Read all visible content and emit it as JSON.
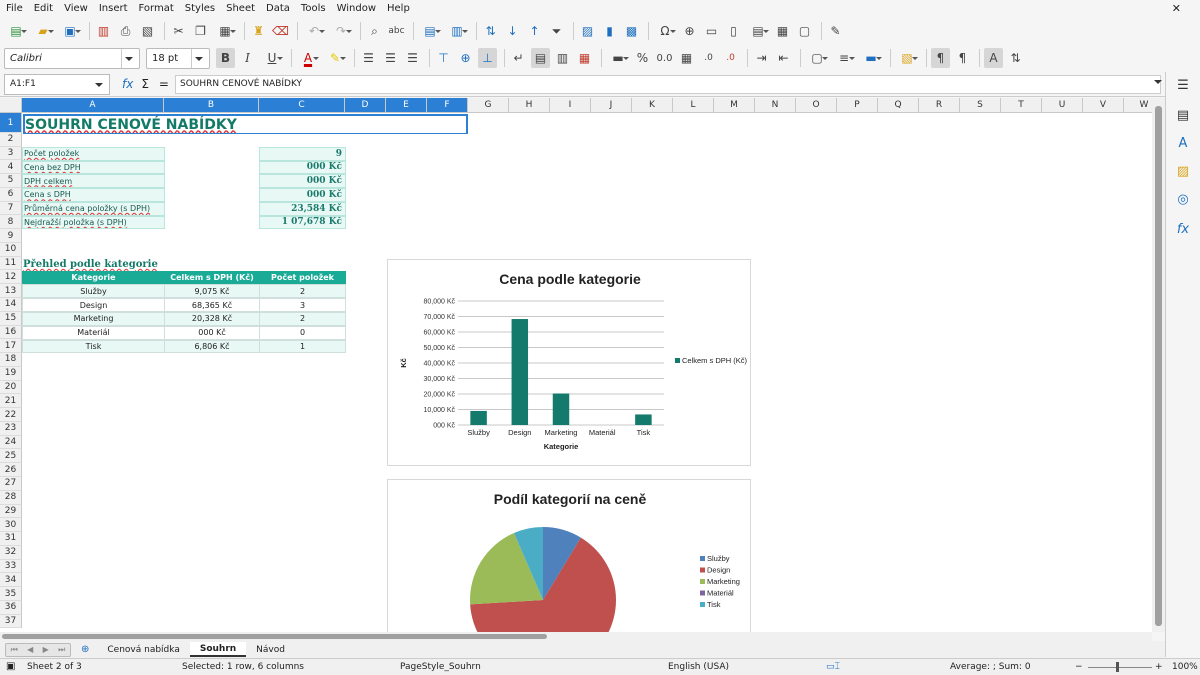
{
  "menu": [
    "File",
    "Edit",
    "View",
    "Insert",
    "Format",
    "Styles",
    "Sheet",
    "Data",
    "Tools",
    "Window",
    "Help"
  ],
  "font": {
    "name": "Calibri",
    "size": "18 pt"
  },
  "formula_bar": {
    "name_box": "A1:F1",
    "fx": "fx",
    "sigma": "Σ",
    "equals": "=",
    "content": "SOUHRN CENOVÉ NABÍDKY"
  },
  "columns": [
    "A",
    "B",
    "C",
    "D",
    "E",
    "F",
    "G",
    "H",
    "I",
    "J",
    "K",
    "L",
    "M",
    "N",
    "O",
    "P",
    "Q",
    "R",
    "S",
    "T",
    "U",
    "V",
    "W"
  ],
  "rows": [
    "1",
    "2",
    "3",
    "4",
    "5",
    "6",
    "7",
    "8",
    "9",
    "10",
    "11",
    "12",
    "13",
    "14",
    "15",
    "16",
    "17",
    "18",
    "19",
    "20",
    "21",
    "22",
    "23",
    "24",
    "25",
    "26",
    "27",
    "28",
    "29",
    "30",
    "31",
    "32",
    "33",
    "34",
    "35",
    "36",
    "37"
  ],
  "sheet": {
    "title": "SOUHRN CENOVÉ NABÍDKY",
    "summary": [
      {
        "label": "Počet položek",
        "value": "9"
      },
      {
        "label": "Cena bez DPH",
        "value": "000 Kč"
      },
      {
        "label": "DPH celkem",
        "value": "000 Kč"
      },
      {
        "label": "Cena s DPH",
        "value": "000 Kč"
      },
      {
        "label": "Průměrná cena položky (s DPH)",
        "value": "23,584 Kč"
      },
      {
        "label": "Nejdražší položka (s DPH)",
        "value": "1 07,678 Kč"
      }
    ],
    "category_title": "Přehled podle kategorie",
    "category_headers": [
      "Kategorie",
      "Celkem s DPH (Kč)",
      "Počet položek"
    ],
    "category_rows": [
      {
        "name": "Služby",
        "total": "9,075 Kč",
        "count": "2"
      },
      {
        "name": "Design",
        "total": "68,365 Kč",
        "count": "3"
      },
      {
        "name": "Marketing",
        "total": "20,328 Kč",
        "count": "2"
      },
      {
        "name": "Materiál",
        "total": "000 Kč",
        "count": "0"
      },
      {
        "name": "Tisk",
        "total": "6,806 Kč",
        "count": "1"
      }
    ]
  },
  "chart_data": [
    {
      "type": "bar",
      "title": "Cena podle kategorie",
      "xlabel": "Kategorie",
      "ylabel": "Kč",
      "categories": [
        "Služby",
        "Design",
        "Marketing",
        "Materiál",
        "Tisk"
      ],
      "series": [
        {
          "name": "Celkem s DPH (Kč)",
          "values": [
            9075,
            68365,
            20328,
            0,
            6806
          ]
        }
      ],
      "ylim": [
        0,
        80000
      ],
      "yticks": [
        "000 Kč",
        "10,000 Kč",
        "20,000 Kč",
        "30,000 Kč",
        "40,000 Kč",
        "50,000 Kč",
        "60,000 Kč",
        "70,000 Kč",
        "80,000 Kč"
      ],
      "bar_color": "#137a6c",
      "grid": true,
      "legend": "right"
    },
    {
      "type": "pie",
      "title": "Podíl kategorií na ceně",
      "categories": [
        "Služby",
        "Design",
        "Marketing",
        "Materiál",
        "Tisk"
      ],
      "values": [
        9075,
        68365,
        20328,
        0,
        6806
      ],
      "colors": [
        "#4f81bd",
        "#c0504d",
        "#9bbb59",
        "#8064a2",
        "#4bacc6"
      ],
      "legend": "right"
    }
  ],
  "tabs": {
    "items": [
      "Cenová nabídka",
      "Souhrn",
      "Návod"
    ],
    "active": "Souhrn"
  },
  "status": {
    "sheet": "Sheet 2 of 3",
    "selection": "Selected: 1 row, 6 columns",
    "pagestyle": "PageStyle_Souhrn",
    "language": "English (USA)",
    "aggregate": "Average: ; Sum: 0",
    "zoom": "100%"
  }
}
